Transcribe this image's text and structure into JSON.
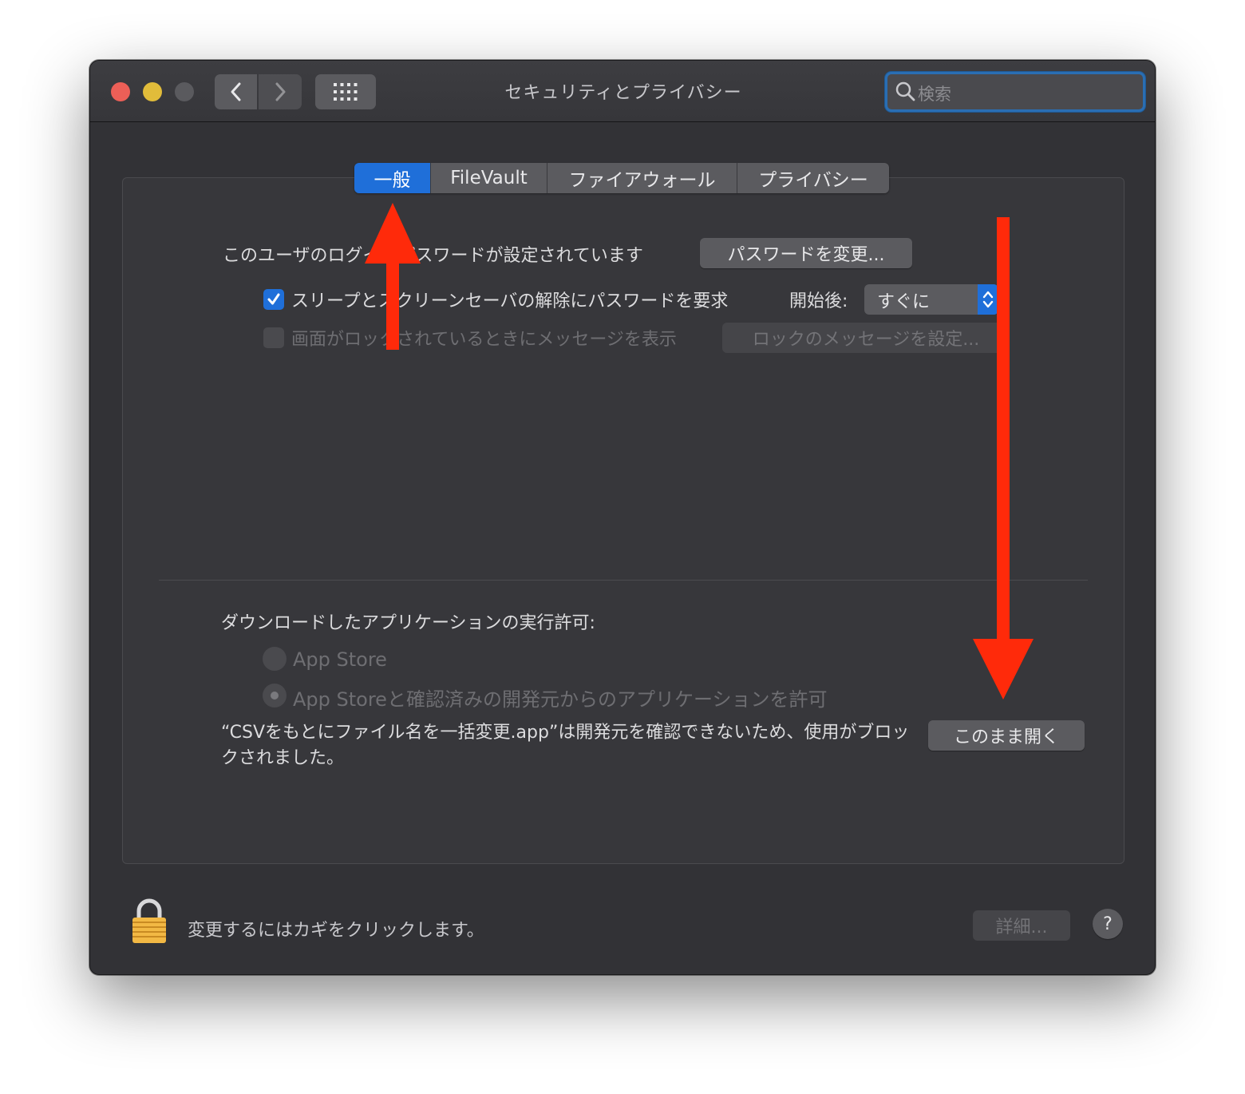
{
  "window": {
    "title": "セキュリティとプライバシー",
    "search_placeholder": "検索"
  },
  "tabs": [
    {
      "label": "一般",
      "active": true
    },
    {
      "label": "FileVault",
      "active": false
    },
    {
      "label": "ファイアウォール",
      "active": false
    },
    {
      "label": "プライバシー",
      "active": false
    }
  ],
  "general": {
    "login_password_text": "このユーザのログインパスワードが設定されています",
    "change_password_button": "パスワードを変更...",
    "require_password_label": "スリープとスクリーンセーバの解除にパスワードを要求",
    "require_password_checked": true,
    "after_label": "開始後:",
    "after_value": "すぐに",
    "lock_message_label": "画面がロックされているときにメッセージを表示",
    "lock_message_checked": false,
    "lock_message_button": "ロックのメッセージを設定..."
  },
  "downloads": {
    "heading": "ダウンロードしたアプリケーションの実行許可:",
    "options": [
      {
        "label": "App Store",
        "selected": false
      },
      {
        "label": "App Storeと確認済みの開発元からのアプリケーションを許可",
        "selected": true
      }
    ],
    "blocked_message": "“CSVをもとにファイル名を一括変更.app”は開発元を確認できないため、使用がブロックされました。",
    "open_anyway_button": "このまま開く"
  },
  "footer": {
    "lock_text": "変更するにはカギをクリックします。",
    "advanced_button": "詳細...",
    "help_button": "?"
  },
  "colors": {
    "accent": "#1f6fd9",
    "annotation_arrow": "#ff2a0a",
    "window_bg": "#323236"
  }
}
